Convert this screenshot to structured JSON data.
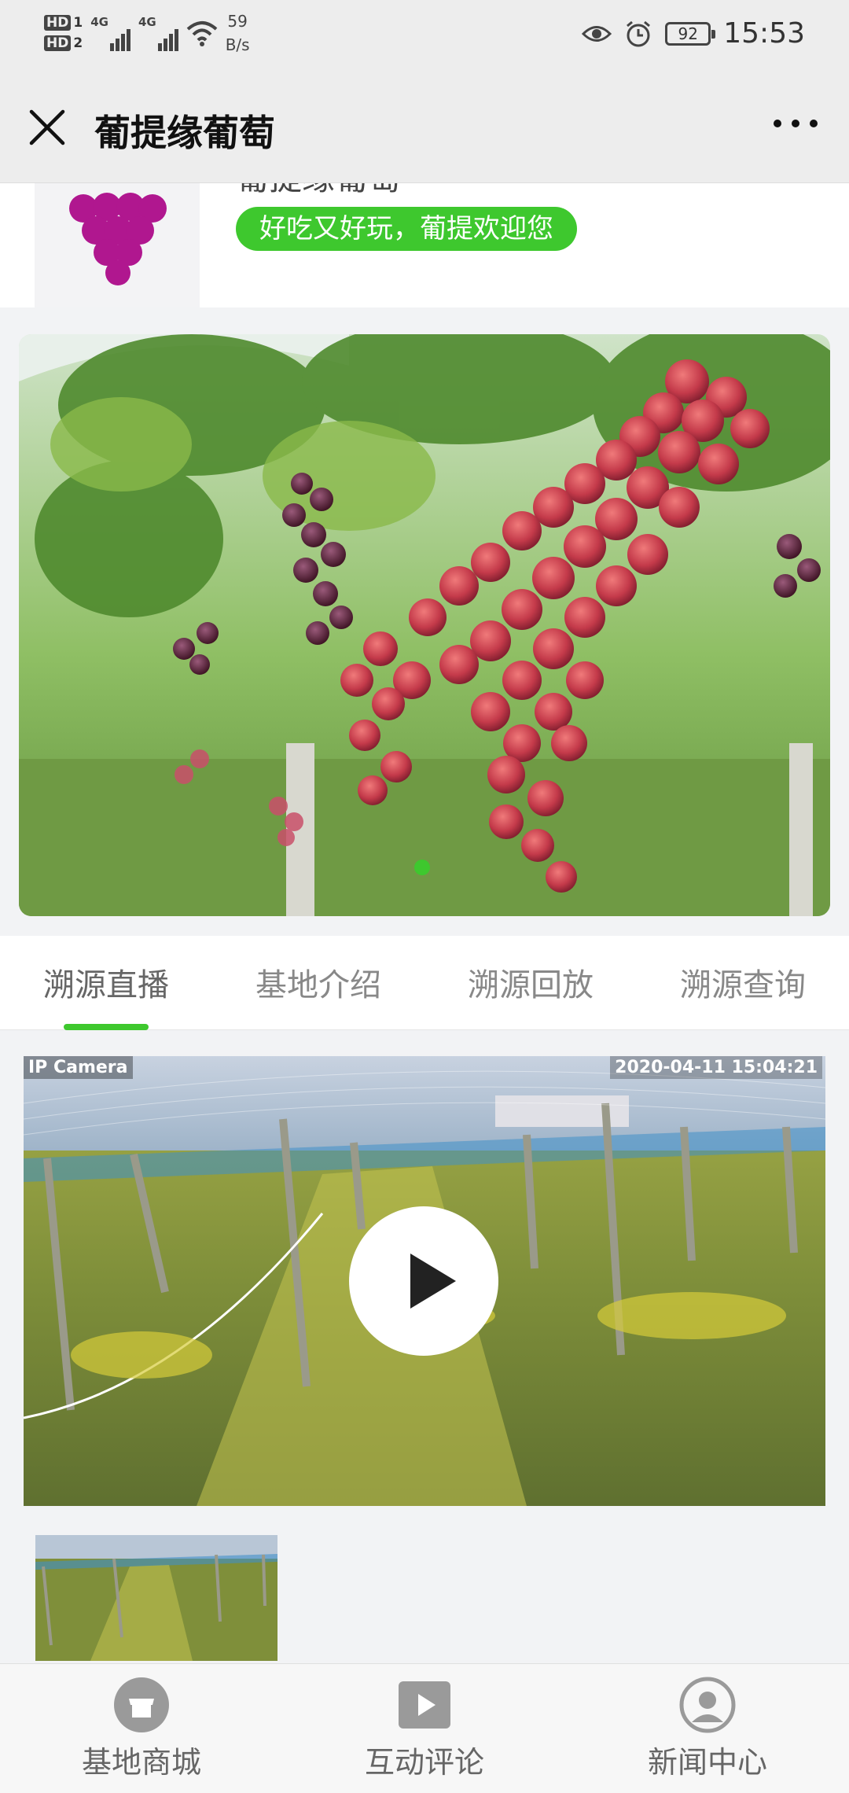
{
  "status_bar": {
    "hd1": "HD",
    "hd1_sub": "1",
    "hd2": "HD",
    "hd2_sub": "2",
    "net1": "4G",
    "net2": "4G",
    "speed_value": "59",
    "speed_unit": "B/s",
    "battery": "92",
    "time": "15:53"
  },
  "nav": {
    "title": "葡提缘葡萄"
  },
  "header": {
    "brand_name": "葡提缘葡萄",
    "slogan": "好吃又好玩，葡提欢迎您"
  },
  "tabs": [
    {
      "label": "溯源直播",
      "active": true
    },
    {
      "label": "基地介绍",
      "active": false
    },
    {
      "label": "溯源回放",
      "active": false
    },
    {
      "label": "溯源查询",
      "active": false
    }
  ],
  "video": {
    "camera_label": "IP Camera",
    "timestamp": "2020-04-11 15:04:21"
  },
  "bottom_nav": [
    {
      "label": "基地商城",
      "icon": "store-icon"
    },
    {
      "label": "互动评论",
      "icon": "play-icon"
    },
    {
      "label": "新闻中心",
      "icon": "user-icon"
    }
  ],
  "colors": {
    "accent": "#3ec82e",
    "grape": "#b0178f"
  }
}
